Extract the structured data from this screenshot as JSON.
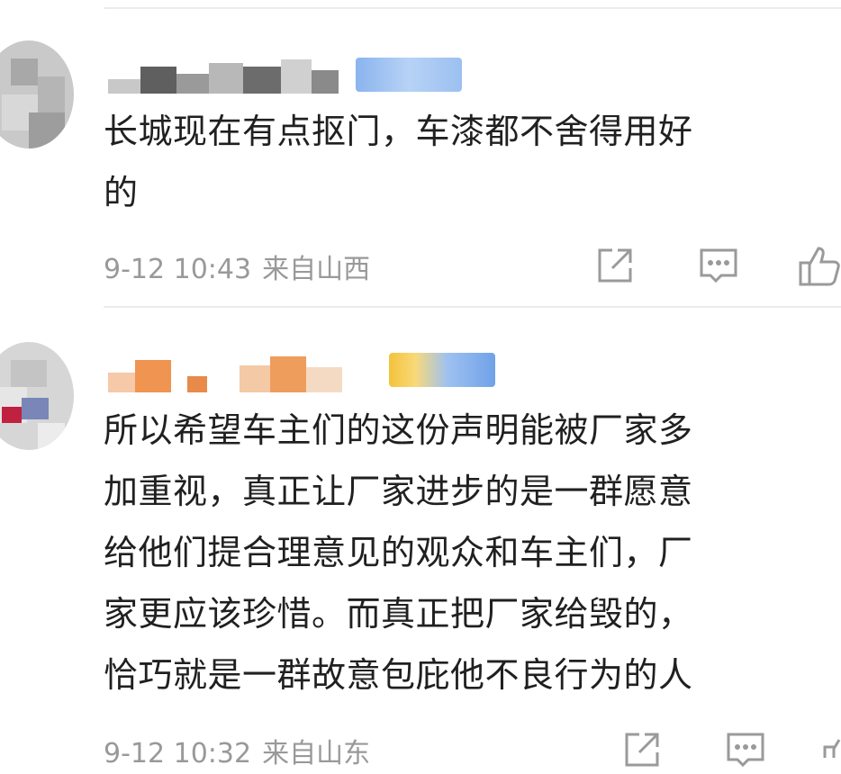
{
  "comments": [
    {
      "username": "",
      "text_lines": [
        "长城现在有点抠门，车漆都不舍得用好",
        "的"
      ],
      "time": "9-12 10:43",
      "region": "来自山西",
      "actions": {
        "share": "share-icon",
        "reply": "comment-icon",
        "like": "thumbs-up-icon"
      }
    },
    {
      "username": "",
      "text_lines": [
        "所以希望车主们的这份声明能被厂家多",
        "加重视，真正让厂家进步的是一群愿意",
        "给他们提合理意见的观众和车主们，厂",
        "家更应该珍惜。而真正把厂家给毁的，",
        "恰巧就是一群故意包庇他不良行为的人"
      ],
      "time": "9-12 10:32",
      "region": "来自山东",
      "actions": {
        "share": "share-icon",
        "reply": "comment-icon",
        "like": "thumbs-up-icon"
      }
    }
  ],
  "colors": {
    "text": "#202020",
    "meta": "#999999",
    "icon": "#9a9a9a",
    "divider": "#ececec"
  }
}
